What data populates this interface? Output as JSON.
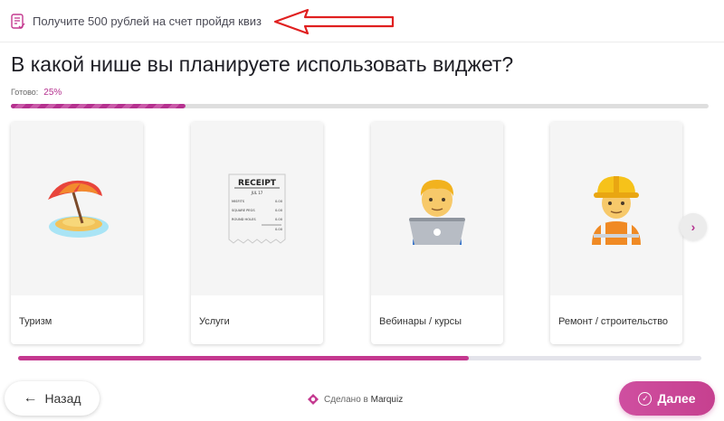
{
  "promo": {
    "text": "Получите 500 рублей на счет пройдя квиз",
    "icon": "survey-icon"
  },
  "question": "В какой нише вы планируете использовать виджет?",
  "progress": {
    "label": "Готово:",
    "percent_text": "25%",
    "value": 0.25
  },
  "cards": [
    {
      "label": "Туризм",
      "icon": "beach-umbrella-island-emoji"
    },
    {
      "label": "Услуги",
      "icon": "receipt-emoji"
    },
    {
      "label": "Вебинары / курсы",
      "icon": "technologist-emoji"
    },
    {
      "label": "Ремонт / строительство",
      "icon": "construction-worker-emoji"
    }
  ],
  "receipt": {
    "title": "RECEIPT",
    "date": "JUL 17",
    "rows": [
      {
        "name": "MISFITS",
        "amt": "0.00"
      },
      {
        "name": "SQUARE PEGS",
        "amt": "0.00"
      },
      {
        "name": "ROUND HOLES",
        "amt": "0.00"
      }
    ],
    "total": "0.00"
  },
  "carousel": {
    "next_icon": "chevron-right-icon",
    "scroll_position": 0.66
  },
  "footer": {
    "back_label": "Назад",
    "made_by_prefix": "Сделано в",
    "made_by_brand": "Marquiz",
    "next_label": "Далее"
  },
  "colors": {
    "accent": "#c4388f",
    "annotation_arrow": "#e02020"
  }
}
